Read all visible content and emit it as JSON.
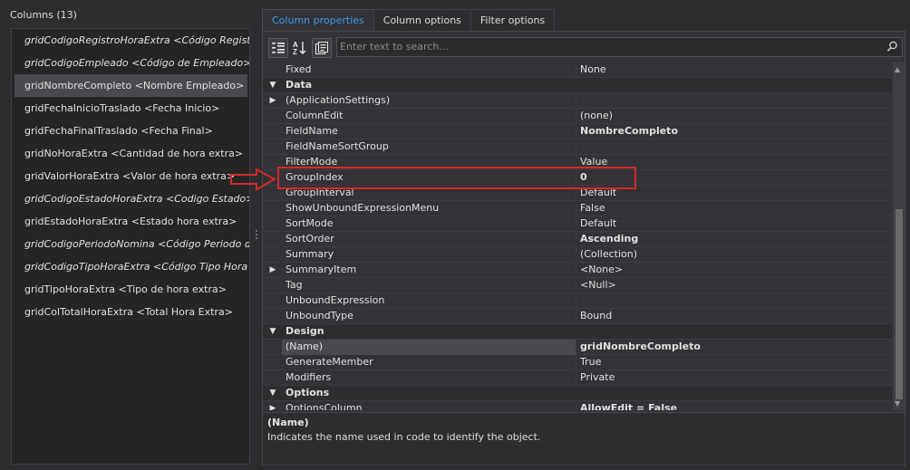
{
  "columns": {
    "title": "Columns (13)",
    "items": [
      {
        "label": "gridCodigoRegistroHoraExtra <Código Registro H",
        "italic": true
      },
      {
        "label": "gridCodigoEmpleado <Código de Empleado>",
        "italic": true
      },
      {
        "label": "gridNombreCompleto <Nombre Empleado>",
        "italic": false,
        "selected": true
      },
      {
        "label": "gridFechaInicioTraslado <Fecha Inicio>",
        "italic": false
      },
      {
        "label": "gridFechaFinalTraslado <Fecha Final>",
        "italic": false
      },
      {
        "label": "gridNoHoraExtra <Cantidad de hora extra>",
        "italic": false
      },
      {
        "label": "gridValorHoraExtra <Valor de hora extra>",
        "italic": false
      },
      {
        "label": "gridCodigoEstadoHoraExtra <Codigo Estado>",
        "italic": true
      },
      {
        "label": "gridEstadoHoraExtra <Estado hora extra>",
        "italic": false
      },
      {
        "label": "gridCodigoPeriodoNomina <Código Periodo de No",
        "italic": true
      },
      {
        "label": "gridCodigoTipoHoraExtra <Código Tipo Hora Extr",
        "italic": true
      },
      {
        "label": "gridTipoHoraExtra <Tipo de hora extra>",
        "italic": false
      },
      {
        "label": "gridColTotalHoraExtra <Total Hora Extra>",
        "italic": false
      }
    ]
  },
  "tabs": [
    {
      "label": "Column properties",
      "active": true
    },
    {
      "label": "Column options",
      "active": false
    },
    {
      "label": "Filter options",
      "active": false
    }
  ],
  "toolbar": {
    "categorized_icon": "categorized-icon",
    "alphabetical_icon": "alphabetical-icon",
    "property_pages_icon": "property-pages-icon"
  },
  "search": {
    "placeholder": "Enter text to search..."
  },
  "properties": [
    {
      "type": "prop",
      "name": "Fixed",
      "value": "None"
    },
    {
      "type": "cat",
      "name": "Data",
      "expander": "▼"
    },
    {
      "type": "prop",
      "name": "(ApplicationSettings)",
      "value": "",
      "expander": "▶"
    },
    {
      "type": "prop",
      "name": "ColumnEdit",
      "value": "(none)"
    },
    {
      "type": "prop",
      "name": "FieldName",
      "value": "NombreCompleto",
      "bold": true
    },
    {
      "type": "prop",
      "name": "FieldNameSortGroup",
      "value": ""
    },
    {
      "type": "prop",
      "name": "FilterMode",
      "value": "Value"
    },
    {
      "type": "prop",
      "name": "GroupIndex",
      "value": "0",
      "bold": true
    },
    {
      "type": "prop",
      "name": "GroupInterval",
      "value": "Default"
    },
    {
      "type": "prop",
      "name": "ShowUnboundExpressionMenu",
      "value": "False"
    },
    {
      "type": "prop",
      "name": "SortMode",
      "value": "Default"
    },
    {
      "type": "prop",
      "name": "SortOrder",
      "value": "Ascending",
      "bold": true
    },
    {
      "type": "prop",
      "name": "Summary",
      "value": "(Collection)"
    },
    {
      "type": "prop",
      "name": "SummaryItem",
      "value": "<None>",
      "expander": "▶"
    },
    {
      "type": "prop",
      "name": "Tag",
      "value": "<Null>"
    },
    {
      "type": "prop",
      "name": "UnboundExpression",
      "value": ""
    },
    {
      "type": "prop",
      "name": "UnboundType",
      "value": "Bound"
    },
    {
      "type": "cat",
      "name": "Design",
      "expander": "▼"
    },
    {
      "type": "prop",
      "name": "(Name)",
      "value": "gridNombreCompleto",
      "bold": true,
      "selected": true
    },
    {
      "type": "prop",
      "name": "GenerateMember",
      "value": "True"
    },
    {
      "type": "prop",
      "name": "Modifiers",
      "value": "Private"
    },
    {
      "type": "cat",
      "name": "Options",
      "expander": "▼"
    },
    {
      "type": "prop",
      "name": "OptionsColumn",
      "value": "AllowEdit = False",
      "bold": true,
      "expander": "▶"
    }
  ],
  "description": {
    "title": "(Name)",
    "text": "Indicates the name used in code to identify the object."
  },
  "colors": {
    "highlight": "#d42a2a",
    "active_tab": "#3e9df0"
  }
}
